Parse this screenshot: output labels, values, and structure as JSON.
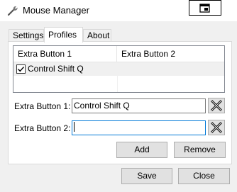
{
  "window": {
    "title": "Mouse Manager",
    "title_icon": "wrench-icon",
    "restore_icon": "restore-window-icon"
  },
  "tabs": [
    {
      "label": "Settings",
      "selected": false
    },
    {
      "label": "Profiles",
      "selected": true
    },
    {
      "label": "About",
      "selected": false
    }
  ],
  "profiles_list": {
    "columns": [
      "Extra Button 1",
      "Extra Button 2"
    ],
    "rows": [
      {
        "checked": true,
        "button1": "Control Shift Q",
        "button2": ""
      }
    ]
  },
  "fields": {
    "button1_label": "Extra Button 1:",
    "button1_value": "Control Shift Q",
    "button2_label": "Extra Button 2:",
    "button2_value": "",
    "clear_icon": "clear-x-icon"
  },
  "buttons": {
    "add": "Add",
    "remove": "Remove",
    "save": "Save",
    "close": "Close"
  },
  "colors": {
    "focus_accent": "#0078d7"
  }
}
